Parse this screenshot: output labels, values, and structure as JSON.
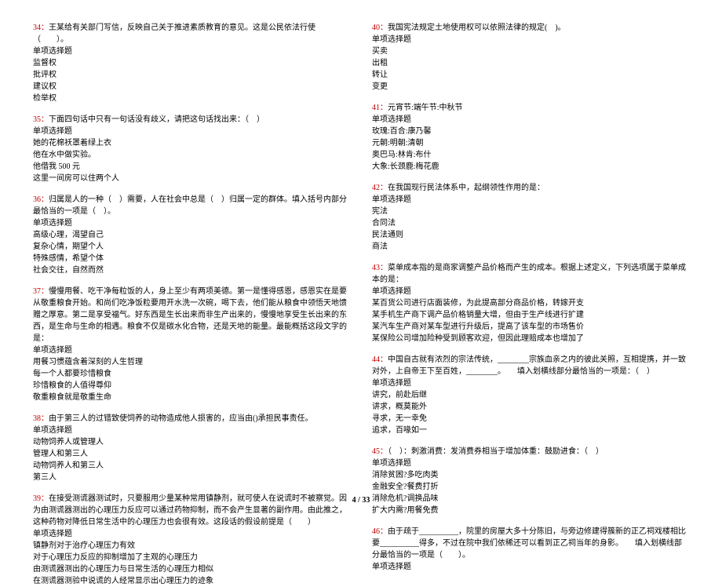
{
  "pager": "4 / 33",
  "left": {
    "q34": {
      "num": "34：",
      "stem": "王某给有关部门写信，反映自己关于推进素质教育的意见。这是公民依法行使（　　）。",
      "type": "单项选择题",
      "opts": [
        "监督权",
        "批评权",
        "建议权",
        "检举权"
      ]
    },
    "q35": {
      "num": "35：",
      "stem": "下面四句话中只有一句话没有歧义，请把这句话找出来：（　）",
      "type": "单项选择题",
      "opts": [
        "她的花棉袄罩着绿上衣",
        "他在水中做实验。",
        "他借我 500 元",
        "这里一间房可以住两个人"
      ]
    },
    "q36": {
      "num": "36：",
      "stem": "归属是人的一种（　）需要，人在社会中总是（　）归属一定的群体。填入括号内部分最恰当的一项是（　）。",
      "type": "单项选择题",
      "opts": [
        "高级心理，渴望自己",
        "复杂心情，期望个人",
        "特殊感情，希望个体",
        "社会交往，自然而然"
      ]
    },
    "q37": {
      "num": "37：",
      "stem": "慢慢用餐、吃干净每粒饭的人，身上至少有两项美德。第一是懂得感恩，感恩实在是要从敬重粮食开始。和尚们吃净饭粒要用开水洗一次碗，喝下去，他们能从粮食中领悟天地馈赠之厚意。第二是享受福气。好东西是生长出来而非生产出来的，慢慢地享受生长出来的东西，是生命与生命的相遇。粮食不仅是碳水化合物，还是天地的能量。最能概括这段文字的是：",
      "type": "单项选择题",
      "opts": [
        "用餐习惯蕴含着深刻的人生哲理",
        "每一个人都要珍惜粮食",
        "珍惜粮食的人值得尊仰",
        "敬重粮食就是敬重生命"
      ]
    },
    "q38": {
      "num": "38：",
      "stem": "由于第三人的过错致使饲养的动物造成他人损害的，应当由()承担民事责任。",
      "type": "单项选择题",
      "opts": [
        "动物饲养人或管理人",
        "管理人和第三人",
        "动物饲养人和第三人",
        "第三人"
      ]
    },
    "q39": {
      "num": "39：",
      "stem": "在接受测谎器测试时，只要服用少量某种常用镇静剂，就可使人在说谎时不被察觉。因为由测谎器测出的心理压力反应可以通过药物抑制，而不会产生显著的副作用。由此推之，这种药物对降低日常生活中的心理压力也会很有效。这段话的假设前提是（　　）",
      "type": "单项选择题",
      "opts": [
        "镇静剂对于治疗心理压力有效",
        "对于心理压力反应的抑制增加了主观的心理压力",
        "由测谎器测出的心理压力与日常生活的心理压力相似",
        "在测谎器测验中说谎的人经常显示出心理压力的迹象"
      ]
    }
  },
  "right": {
    "q40": {
      "num": "40：",
      "stem": "我国宪法规定土地使用权可以依照法律的规定(　)。",
      "type": "单项选择题",
      "opts": [
        "买卖",
        "出租",
        "转让",
        "变更"
      ]
    },
    "q41": {
      "num": "41：",
      "stem": "元宵节:端午节:中秋节",
      "type": "单项选择题",
      "opts": [
        "玫瑰:百合:康乃馨",
        "元朝:明朝:清朝",
        "奥巴马:林肯:布什",
        "大象:长颈鹿:梅花鹿"
      ]
    },
    "q42": {
      "num": "42：",
      "stem": "在我国现行民法体系中，起纲领性作用的是：",
      "type": "单项选择题",
      "opts": [
        "宪法",
        "合同法",
        "民法通则",
        "商法"
      ]
    },
    "q43": {
      "num": "43：",
      "stem": "菜单成本指的是商家调整产品价格而产生的成本。根据上述定义，下列选项属于菜单成本的是：",
      "type": "单项选择题",
      "opts": [
        "某百货公司进行店面装修，为此提高部分商品价格，转嫁开支",
        "某手机生产商下调产品价格销量大增，但由于生产线进行扩建",
        "某汽车生产商对某车型进行升级后，提高了该车型的市场售价",
        "某保险公司增加险种受到顾客欢迎，但因此理赔成本也增加了"
      ]
    },
    "q44": {
      "num": "44：",
      "stem": "中国自古就有浓烈的宗法传统，________宗族血亲之内的彼此关照，互相提携，并一致对外，上自帝王下至百姓，________。　　填入划横线部分最恰当的一项是：（　）",
      "type": "单项选择题",
      "opts": [
        "讲究，前赴后继",
        "讲求，概莫能外",
        "寻求，无一幸免",
        "追求，百喙如一"
      ]
    },
    "q45": {
      "num": "45：",
      "stem": "（　）：刺激消费：发消费券相当于增加体重：鼓励进食：（　）",
      "type": "单项选择题",
      "opts": [
        "消除贫困?多吃肉类",
        "金融安全?餐费打折",
        "消除危机?调换品味",
        "扩大内需?用餐免费"
      ]
    },
    "q46": {
      "num": "46：",
      "stem": "由于疏于__________，院里的房屋大多十分陈旧，与旁边修建得簇新的正乙祠戏楼相比要__________得多，不过在院中我们依稀还可以看到正乙祠当年的身影。　　填入划横线部分最恰当的一项是（　　）。",
      "type": "单项选择题"
    }
  }
}
